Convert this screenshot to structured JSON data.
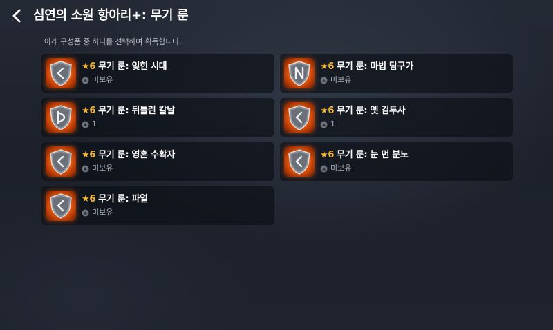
{
  "header": {
    "title": "심연의 소원 항아리+: 무기 룬"
  },
  "subtitle": "아래 구성품 중 하나를 선택하여 획득합니다.",
  "items": [
    {
      "star": "★",
      "grade": "6",
      "name": "무기 룬: 잊힌 시대",
      "owned": "미보유",
      "glyph": "chevron-left"
    },
    {
      "star": "★",
      "grade": "6",
      "name": "무기 룬: 마법 탐구가",
      "owned": "미보유",
      "glyph": "hourglass-n"
    },
    {
      "star": "★",
      "grade": "6",
      "name": "무기 룬: 뒤틀린 칼날",
      "owned": "1",
      "glyph": "thorn-d"
    },
    {
      "star": "★",
      "grade": "6",
      "name": "무기 룬: 옛 검투사",
      "owned": "1",
      "glyph": "chevron-left"
    },
    {
      "star": "★",
      "grade": "6",
      "name": "무기 룬: 영혼 수확자",
      "owned": "미보유",
      "glyph": "chevron-left"
    },
    {
      "star": "★",
      "grade": "6",
      "name": "무기 룬: 눈 먼 분노",
      "owned": "미보유",
      "glyph": "chevron-left"
    },
    {
      "star": "★",
      "grade": "6",
      "name": "무기 룬: 파열",
      "owned": "미보유",
      "glyph": "chevron-left"
    }
  ],
  "colors": {
    "grade_star": "#f5b731",
    "rune_glow": "#ff6a14"
  }
}
